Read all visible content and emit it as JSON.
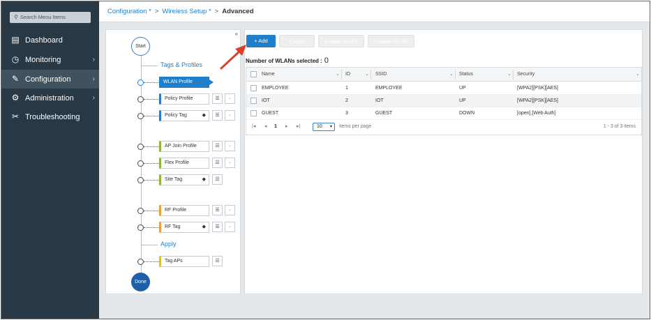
{
  "sidebar": {
    "search_placeholder": "Search Menu Items",
    "items": [
      {
        "label": "Dashboard",
        "icon": "dashboard-icon",
        "has_children": false
      },
      {
        "label": "Monitoring",
        "icon": "monitoring-icon",
        "has_children": true
      },
      {
        "label": "Configuration",
        "icon": "configuration-icon",
        "has_children": true,
        "active": true
      },
      {
        "label": "Administration",
        "icon": "administration-icon",
        "has_children": true
      },
      {
        "label": "Troubleshooting",
        "icon": "troubleshooting-icon",
        "has_children": false
      }
    ]
  },
  "breadcrumb": {
    "level1": "Configuration *",
    "level2": "Wireless Setup *",
    "current": "Advanced",
    "separator": ">"
  },
  "wizard": {
    "start_label": "Start",
    "done_label": "Done",
    "section_tags": "Tags & Profiles",
    "section_apply": "Apply",
    "steps": {
      "wlan_profile": "WLAN Profile",
      "policy_profile": "Policy Profile",
      "policy_tag": "Policy Tag",
      "ap_join_profile": "AP Join Profile",
      "flex_profile": "Flex Profile",
      "site_tag": "Site Tag",
      "rf_profile": "RF Profile",
      "rf_tag": "RF Tag",
      "tag_aps": "Tag APs"
    },
    "close_glyph": "«"
  },
  "toolbar": {
    "add_label": "+ Add",
    "delete_label": "Delete",
    "enable_label": "Enable WLAN",
    "disable_label": "Disable WLAN"
  },
  "selection": {
    "label": "Number of WLANs selected :",
    "count": "0"
  },
  "table": {
    "columns": [
      "Name",
      "ID",
      "SSID",
      "Status",
      "Security"
    ],
    "rows": [
      {
        "name": "EMPLOYEE",
        "id": "1",
        "ssid": "EMPLOYEE",
        "status": "UP",
        "security": "[WPA2][PSK][AES]"
      },
      {
        "name": "IOT",
        "id": "2",
        "ssid": "IOT",
        "status": "UP",
        "security": "[WPA2][PSK][AES]"
      },
      {
        "name": "GUEST",
        "id": "3",
        "ssid": "GUEST",
        "status": "DOWN",
        "security": "[open],[Web Auth]"
      }
    ]
  },
  "pager": {
    "current_page": "1",
    "per_page": "10",
    "per_page_label": "items per page",
    "summary": "1 - 3 of 3 items"
  },
  "colors": {
    "sidebar_bg": "#283845",
    "accent": "#1f7fcb",
    "annotation_arrow": "#d9412b"
  }
}
